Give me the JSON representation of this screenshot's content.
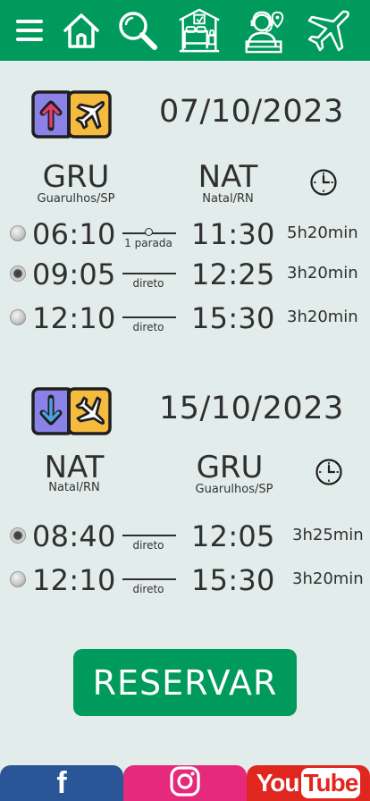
{
  "nav": {
    "items": [
      "menu-icon",
      "home-icon",
      "search-icon",
      "hotel-icon",
      "agent-icon",
      "airplane-icon"
    ]
  },
  "outbound": {
    "date": "07/10/2023",
    "origin_code": "GRU",
    "origin_city": "Guarulhos/SP",
    "dest_code": "NAT",
    "dest_city": "Natal/RN",
    "flights": [
      {
        "depart": "06:10",
        "stops": "1 parada",
        "arrive": "11:30",
        "duration": "5h20min",
        "selected": false
      },
      {
        "depart": "09:05",
        "stops": "direto",
        "arrive": "12:25",
        "duration": "3h20min",
        "selected": true
      },
      {
        "depart": "12:10",
        "stops": "direto",
        "arrive": "15:30",
        "duration": "3h20min",
        "selected": false
      }
    ]
  },
  "return": {
    "date": "15/10/2023",
    "origin_code": "NAT",
    "origin_city": "Natal/RN",
    "dest_code": "GRU",
    "dest_city": "Guarulhos/SP",
    "flights": [
      {
        "depart": "08:40",
        "stops": "direto",
        "arrive": "12:05",
        "duration": "3h25min",
        "selected": true
      },
      {
        "depart": "12:10",
        "stops": "direto",
        "arrive": "15:30",
        "duration": "3h20min",
        "selected": false
      }
    ]
  },
  "reserve_label": "RESERVAR",
  "footer": {
    "facebook_glyph": "f",
    "youtube_you": "You",
    "youtube_tube": "Tube"
  },
  "colors": {
    "brand_green": "#009b5c",
    "background": "#e2ecea",
    "facebook": "#2a5596",
    "instagram": "#e5297b",
    "youtube": "#e0271f"
  }
}
